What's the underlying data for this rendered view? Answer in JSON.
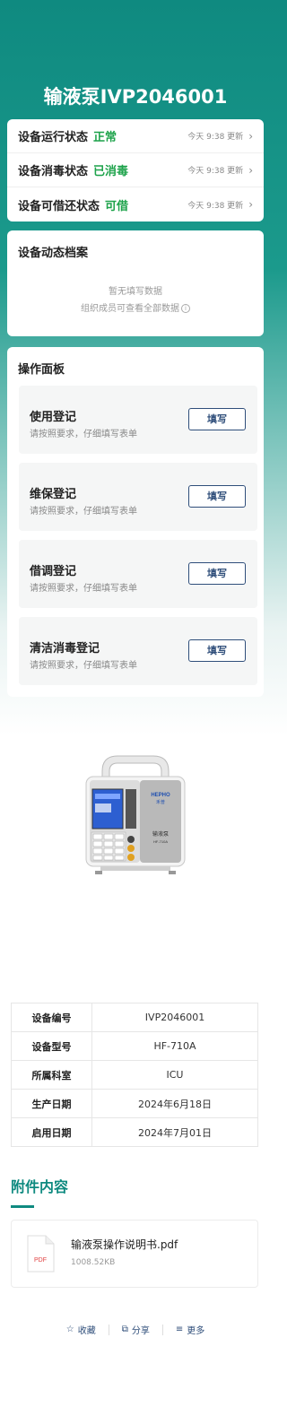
{
  "title": "输液泵IVP2046001",
  "status": [
    {
      "label": "设备运行状态",
      "value": "正常",
      "time": "今天 9:38 更新"
    },
    {
      "label": "设备消毒状态",
      "value": "已消毒",
      "time": "今天 9:38 更新"
    },
    {
      "label": "设备可借还状态",
      "value": "可借",
      "time": "今天 9:38 更新"
    }
  ],
  "archive": {
    "title": "设备动态档案",
    "empty_line1": "暂无填写数据",
    "empty_line2": "组织成员可查看全部数据"
  },
  "ops": {
    "title": "操作面板",
    "items": [
      {
        "title": "使用登记",
        "sub": "请按照要求，仔细填写表单",
        "button": "填写"
      },
      {
        "title": "维保登记",
        "sub": "请按照要求，仔细填写表单",
        "button": "填写"
      },
      {
        "title": "借调登记",
        "sub": "请按照要求，仔细填写表单",
        "button": "填写"
      },
      {
        "title": "清洁消毒登记",
        "sub": "请按照要求，仔细填写表单",
        "button": "填写"
      }
    ]
  },
  "device_image": {
    "brand": "HEPHO",
    "brand_cn": "禾普",
    "label": "输液泵",
    "model": "HF-710A"
  },
  "specs": [
    {
      "key": "设备编号",
      "value": "IVP2046001"
    },
    {
      "key": "设备型号",
      "value": "HF-710A"
    },
    {
      "key": "所属科室",
      "value": "ICU"
    },
    {
      "key": "生产日期",
      "value": "2024年6月18日"
    },
    {
      "key": "启用日期",
      "value": "2024年7月01日"
    }
  ],
  "attachments": {
    "title": "附件内容",
    "file_name": "输液泵操作说明书.pdf",
    "file_size": "1008.52KB",
    "file_type": "PDF"
  },
  "actions": {
    "favorite": "收藏",
    "share": "分享",
    "more": "更多"
  },
  "colors": {
    "primary": "#0f8a80",
    "status_green": "#1ea34b",
    "button_navy": "#2f4e7a"
  }
}
